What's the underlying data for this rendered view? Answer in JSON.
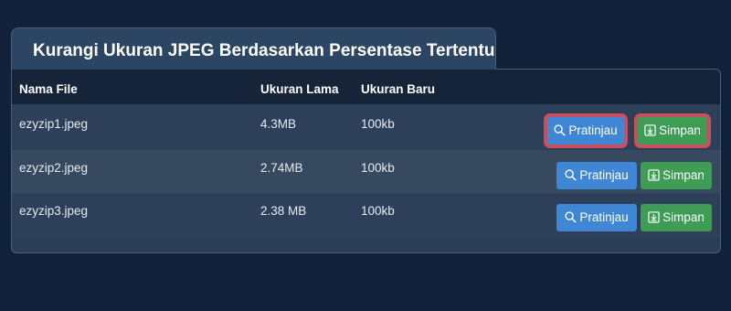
{
  "title": "Kurangi Ukuran JPEG Berdasarkan Persentase Tertentu",
  "table": {
    "headers": [
      "Nama File",
      "Ukuran Lama",
      "Ukuran Baru"
    ],
    "rows": [
      {
        "file": "ezyzip1.jpeg",
        "old_size": "4.3MB",
        "new_size": "100kb"
      },
      {
        "file": "ezyzip2.jpeg",
        "old_size": "2.74MB",
        "new_size": "100kb"
      },
      {
        "file": "ezyzip3.jpeg",
        "old_size": "2.38 MB",
        "new_size": "100kb"
      }
    ]
  },
  "buttons": {
    "preview_label": "Pratinjau",
    "save_label": "Simpan",
    "preview_icon": "search-icon",
    "save_icon": "download-icon"
  },
  "colors": {
    "background": "#11213a",
    "preview": "#3f86d4",
    "save": "#3e9c55",
    "highlight": "#c84f5e"
  }
}
